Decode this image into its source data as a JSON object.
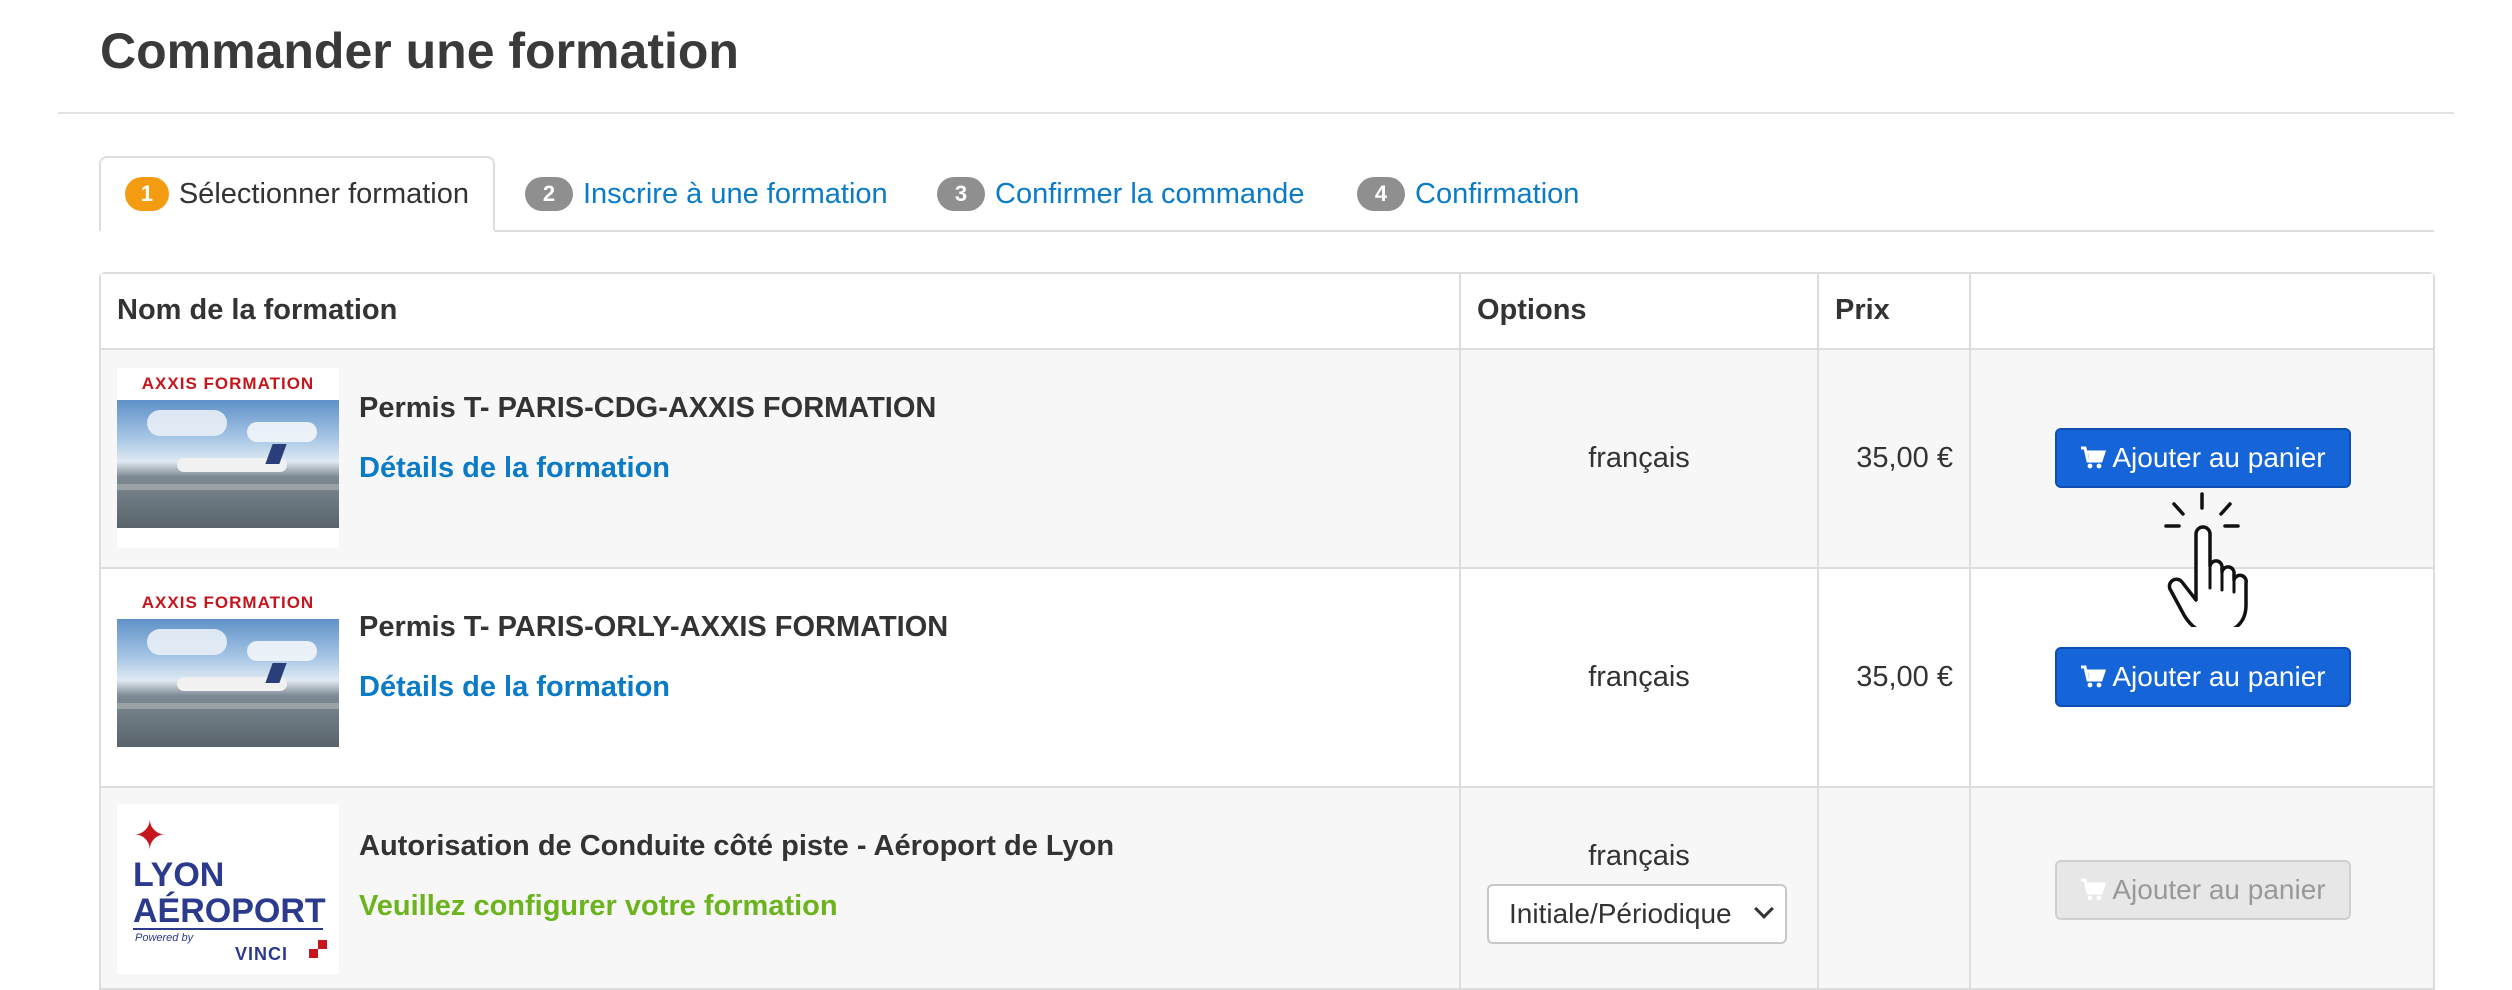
{
  "page": {
    "title": "Commander une formation"
  },
  "steps": [
    {
      "number": "1",
      "label": "Sélectionner formation",
      "active": true
    },
    {
      "number": "2",
      "label": "Inscrire à une formation",
      "active": false
    },
    {
      "number": "3",
      "label": "Confirmer la commande",
      "active": false
    },
    {
      "number": "4",
      "label": "Confirmation",
      "active": false
    }
  ],
  "table": {
    "headers": {
      "name": "Nom de la formation",
      "options": "Options",
      "price": "Prix",
      "action": ""
    },
    "rows": [
      {
        "image_brand": "AXXIS FORMATION",
        "name": "Permis T- PARIS-CDG-AXXIS FORMATION",
        "link": "Détails de la formation",
        "language": "français",
        "price": "35,00 €",
        "button": "Ajouter au panier",
        "button_enabled": true
      },
      {
        "image_brand": "AXXIS FORMATION",
        "name": "Permis T- PARIS-ORLY-AXXIS FORMATION",
        "link": "Détails de la formation",
        "language": "français",
        "price": "35,00 €",
        "button": "Ajouter au panier",
        "button_enabled": true
      },
      {
        "logo": {
          "line1": "LYON",
          "line2": "AÉROPORT",
          "powered": "Powered by",
          "brand": "VINCI"
        },
        "name": "Autorisation de Conduite côté piste - Aéroport de Lyon",
        "warning": "Veuillez configurer votre formation",
        "language": "français",
        "select_value": "Initiale/Périodique",
        "price": "",
        "button": "Ajouter au panier",
        "button_enabled": false
      }
    ]
  },
  "colors": {
    "accent_blue": "#1565d8",
    "link_blue": "#0a7bc6",
    "step_active": "#f39c12",
    "step_inactive": "#8f8f8f",
    "warning_green": "#6cb41e"
  },
  "icons": {
    "cart": "cart-icon",
    "cursor": "hand-pointer-icon",
    "dropdown": "chevron-down-icon"
  }
}
